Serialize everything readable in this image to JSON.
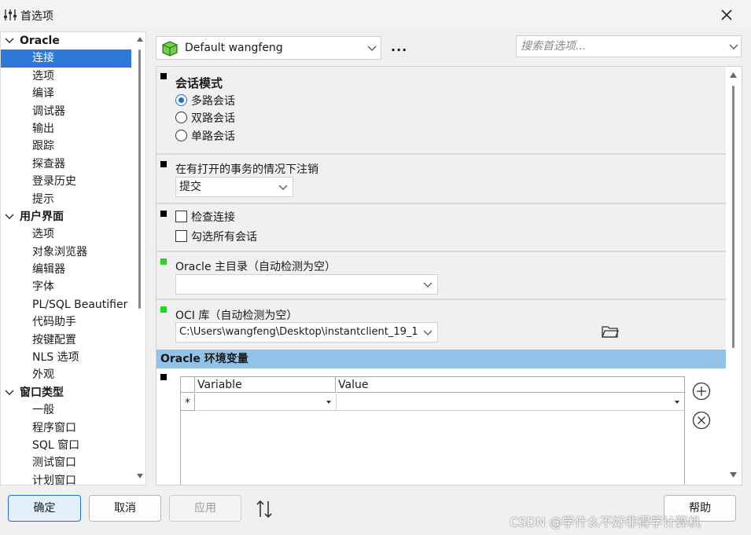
{
  "window": {
    "title": "首选项",
    "icon": "sliders-icon",
    "close_icon": "close-icon"
  },
  "tree": {
    "groups": [
      {
        "label": "Oracle",
        "expanded": true,
        "items": [
          "连接",
          "选项",
          "编译",
          "调试器",
          "输出",
          "跟踪",
          "探查器",
          "登录历史",
          "提示"
        ]
      },
      {
        "label": "用户界面",
        "expanded": true,
        "items": [
          "选项",
          "对象浏览器",
          "编辑器",
          "字体",
          "PL/SQL Beautifier",
          "代码助手",
          "按键配置",
          "NLS 选项",
          "外观"
        ]
      },
      {
        "label": "窗口类型",
        "expanded": true,
        "items": [
          "一般",
          "程序窗口",
          "SQL 窗口",
          "测试窗口",
          "计划窗口"
        ]
      }
    ],
    "selected": "连接"
  },
  "toolbar": {
    "profile": "Default wangfeng",
    "more_label": "...",
    "search_placeholder": "搜索首选项..."
  },
  "sections": {
    "session_mode": {
      "title": "会话模式",
      "options": [
        "多路会话",
        "双路会话",
        "单路会话"
      ],
      "selected": "多路会话"
    },
    "logoff": {
      "label": "在有打开的事务的情况下注销",
      "value": "提交"
    },
    "checks": {
      "items": [
        "检查连接",
        "勾选所有会话"
      ],
      "checked": [
        false,
        false
      ]
    },
    "oracle_home": {
      "label": "Oracle 主目录（自动检测为空）",
      "value": ""
    },
    "oci_lib": {
      "label": "OCI 库（自动检测为空）",
      "value": "C:\\Users\\wangfeng\\Desktop\\instantclient_19_1"
    },
    "env": {
      "title": "Oracle 环境变量",
      "columns": [
        "Variable",
        "Value"
      ],
      "new_row_marker": "*",
      "rows": []
    }
  },
  "buttons": {
    "ok": "确定",
    "cancel": "取消",
    "apply": "应用",
    "help": "帮助"
  },
  "watermark": "CSDN @学什么不好非得学计算机",
  "colors": {
    "accent": "#1a6fd8",
    "selection": "#2e78d7",
    "env_header": "#91c3e8",
    "marker_green": "#22d622"
  }
}
